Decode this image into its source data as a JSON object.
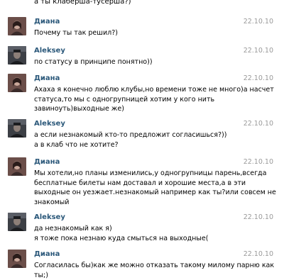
{
  "partial_message": "а ты клаберша-тусерша?)",
  "messages": [
    {
      "author": "Диана",
      "avatar": "diana-avatar",
      "date": "22.10.10",
      "lines": [
        "Почему ты так решил?)"
      ]
    },
    {
      "author": "Aleksey",
      "avatar": "aleksey-avatar",
      "date": "22.10.10",
      "lines": [
        "по статусу в принципе понятно))"
      ]
    },
    {
      "author": "Диана",
      "avatar": "diana-avatar",
      "date": "22.10.10",
      "lines": [
        "Ахаха я конечно люблю клубы,но времени тоже не много)а насчет",
        "статуса,то мы с одногрупницей хотим у кого нить",
        "завиноуть)выходные же)"
      ]
    },
    {
      "author": "Aleksey",
      "avatar": "aleksey-avatar",
      "date": "22.10.10",
      "lines": [
        "а если незнакомый кто-то предложит согласишься?))",
        "а в клаб что не хотите?"
      ]
    },
    {
      "author": "Диана",
      "avatar": "diana-avatar",
      "date": "22.10.10",
      "lines": [
        "Мы хотели,но планы изменились,у одногрупницы парень,всегда",
        "бесплатные билеты нам доставал и хорошие места,а в эти",
        "выходные он уезжает.незнакомый например как ты?или совсем не",
        "знакомый"
      ]
    },
    {
      "author": "Aleksey",
      "avatar": "aleksey-avatar",
      "date": "22.10.10",
      "lines": [
        "да незнакомый как я)",
        "я тоже пока незнаю куда смыться на выходные("
      ]
    },
    {
      "author": "Диана",
      "avatar": "diana-avatar",
      "date": "22.10.10",
      "lines": [
        "Согласилась бы)как же можно отказать такому милому парню как",
        "ты;)"
      ]
    }
  ],
  "colors": {
    "author": "#2b587a",
    "date": "#999999",
    "text": "#000000"
  }
}
